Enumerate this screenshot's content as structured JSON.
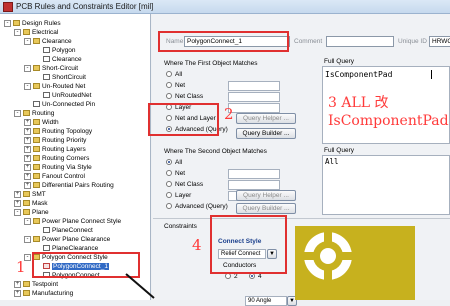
{
  "window": {
    "title": "PCB Rules and Constraints Editor [mil]"
  },
  "tree": {
    "items": [
      {
        "label": "Design Rules",
        "level": 0,
        "icon": "folder",
        "expander": "-"
      },
      {
        "label": "Electrical",
        "level": 1,
        "icon": "folder",
        "expander": "-"
      },
      {
        "label": "Clearance",
        "level": 2,
        "icon": "folder",
        "expander": "-"
      },
      {
        "label": "Polygon",
        "level": 3,
        "icon": "rule"
      },
      {
        "label": "Clearance",
        "level": 3,
        "icon": "rule"
      },
      {
        "label": "Short-Circuit",
        "level": 2,
        "icon": "folder",
        "expander": "-"
      },
      {
        "label": "ShortCircuit",
        "level": 3,
        "icon": "rule"
      },
      {
        "label": "Un-Routed Net",
        "level": 2,
        "icon": "folder",
        "expander": "-"
      },
      {
        "label": "UnRoutedNet",
        "level": 3,
        "icon": "rule"
      },
      {
        "label": "Un-Connected Pin",
        "level": 2,
        "icon": "rule"
      },
      {
        "label": "Routing",
        "level": 1,
        "icon": "folder",
        "expander": "-"
      },
      {
        "label": "Width",
        "level": 2,
        "icon": "folder",
        "expander": "+"
      },
      {
        "label": "Routing Topology",
        "level": 2,
        "icon": "folder",
        "expander": "+"
      },
      {
        "label": "Routing Priority",
        "level": 2,
        "icon": "folder",
        "expander": "+"
      },
      {
        "label": "Routing Layers",
        "level": 2,
        "icon": "folder",
        "expander": "+"
      },
      {
        "label": "Routing Corners",
        "level": 2,
        "icon": "folder",
        "expander": "+"
      },
      {
        "label": "Routing Via Style",
        "level": 2,
        "icon": "folder",
        "expander": "+"
      },
      {
        "label": "Fanout Control",
        "level": 2,
        "icon": "folder",
        "expander": "+"
      },
      {
        "label": "Differential Pairs Routing",
        "level": 2,
        "icon": "folder",
        "expander": "+"
      },
      {
        "label": "SMT",
        "level": 1,
        "icon": "folder",
        "expander": "+"
      },
      {
        "label": "Mask",
        "level": 1,
        "icon": "folder",
        "expander": "+"
      },
      {
        "label": "Plane",
        "level": 1,
        "icon": "folder",
        "expander": "-"
      },
      {
        "label": "Power Plane Connect Style",
        "level": 2,
        "icon": "folder",
        "expander": "-"
      },
      {
        "label": "PlaneConnect",
        "level": 3,
        "icon": "rule"
      },
      {
        "label": "Power Plane Clearance",
        "level": 2,
        "icon": "folder",
        "expander": "-"
      },
      {
        "label": "PlaneClearance",
        "level": 3,
        "icon": "rule"
      },
      {
        "label": "Polygon Connect Style",
        "level": 2,
        "icon": "folder",
        "expander": "-"
      },
      {
        "label": "PolygonConnect_1",
        "level": 3,
        "icon": "rule-red",
        "selected": true
      },
      {
        "label": "PolygonConnect",
        "level": 3,
        "icon": "rule"
      },
      {
        "label": "Testpoint",
        "level": 1,
        "icon": "folder",
        "expander": "+"
      },
      {
        "label": "Manufacturing",
        "level": 1,
        "icon": "folder",
        "expander": "+"
      }
    ]
  },
  "editor": {
    "name_label": "Name",
    "name_value": "PolygonConnect_1",
    "comment_label": "Comment",
    "unique_id_label": "Unique ID",
    "unique_id_value": "HRWO",
    "first_match": {
      "title": "Where The First Object Matches",
      "options": [
        "All",
        "Net",
        "Net Class",
        "Layer",
        "Net and Layer",
        "Advanced (Query)"
      ],
      "selected": "Advanced (Query)",
      "query_helper": "Query Helper ...",
      "query_builder": "Query Builder ..."
    },
    "first_query": {
      "title": "Full Query",
      "text": "IsComponentPad"
    },
    "second_match": {
      "title": "Where The Second Object Matches",
      "options": [
        "All",
        "Net",
        "Net Class",
        "Layer",
        "Advanced (Query)"
      ],
      "selected": "All",
      "query_helper": "Query Helper ...",
      "query_builder": "Query Builder ..."
    },
    "second_query": {
      "title": "Full Query",
      "text": "All"
    },
    "constraints": {
      "title": "Constraints",
      "connect_style_title": "Connect Style",
      "connect_style_value": "Relief Connect",
      "conductors_title": "Conductors",
      "conductor_options": [
        "2",
        "4"
      ],
      "conductors_selected": "4",
      "angle_value": "90 Angle"
    }
  },
  "annotations": {
    "n1": "1",
    "n2": "2",
    "n3_line1": "3 ALL 改",
    "n3_line2": "IsComponentPad",
    "n4": "4"
  },
  "colors": {
    "annotation_red": "#e03030",
    "selection_blue": "#316ac5",
    "pad_copper": "#c7b11e"
  }
}
